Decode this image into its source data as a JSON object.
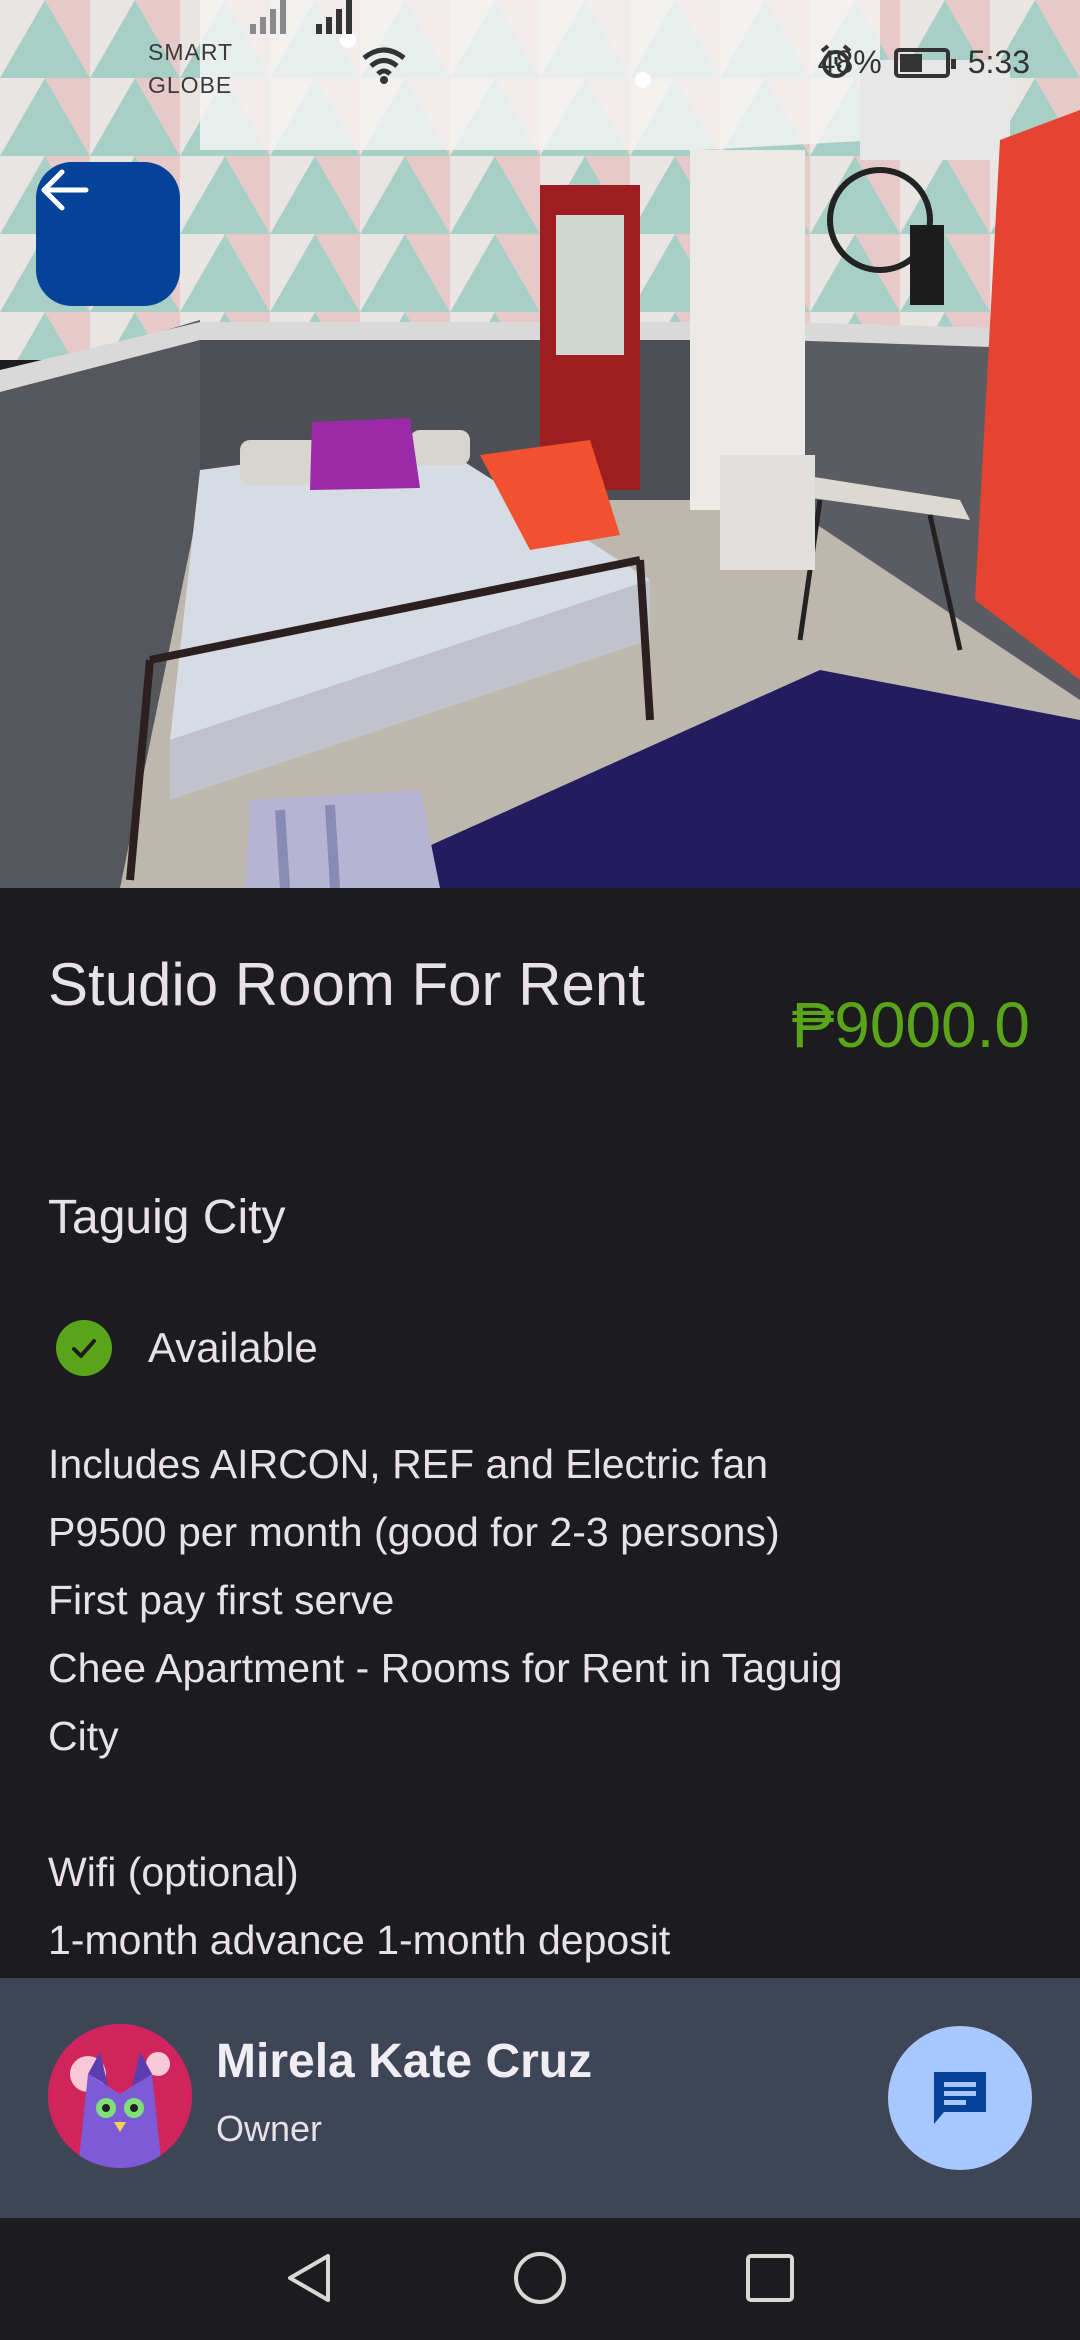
{
  "status_bar": {
    "carrier_line1": "SMART",
    "carrier_line2": "GLOBE",
    "battery_percent": "48%",
    "time": "5:33"
  },
  "listing": {
    "title": "Studio Room For Rent",
    "price": "₱9000.0",
    "location": "Taguig City",
    "availability": "Available",
    "description_lines": [
      "Includes AIRCON, REF and Electric fan",
      "P9500 per month (good for 2-3 persons)",
      "First pay first serve",
      "Chee Apartment - Rooms for Rent in Taguig",
      "City",
      "",
      "Wifi (optional)",
      "1-month advance 1-month deposit"
    ]
  },
  "owner": {
    "name": "Mirela Kate Cruz",
    "role": "Owner"
  },
  "colors": {
    "back_button": "#05439a",
    "price": "#5aa41a",
    "owner_bar": "#3e4556",
    "chat_button": "#a9c7ff"
  }
}
